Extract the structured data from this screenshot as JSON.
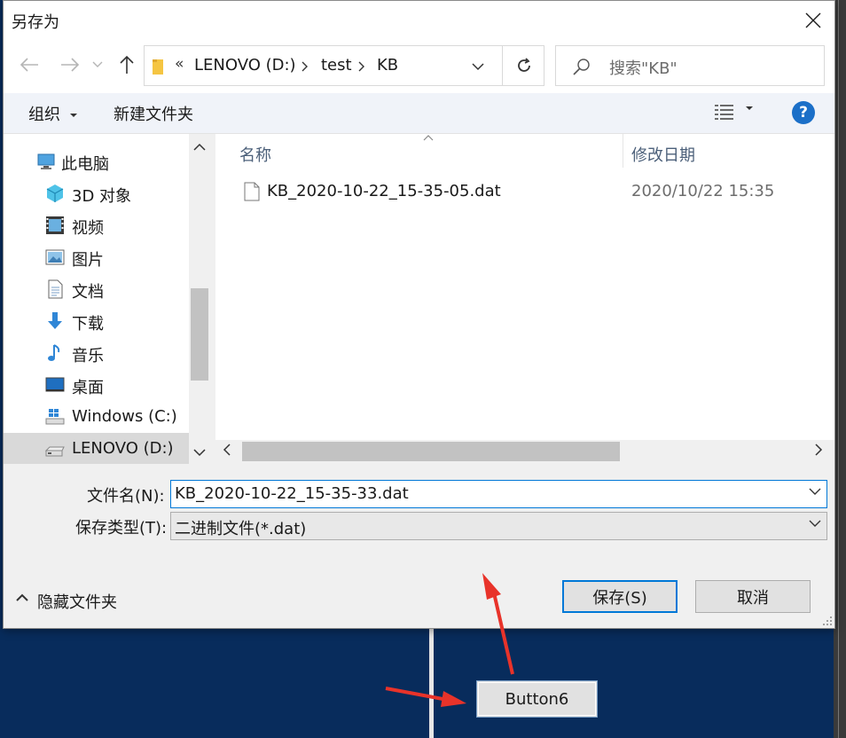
{
  "dialog": {
    "title": "另存为",
    "breadcrumb": {
      "overflow": "«",
      "items": [
        "LENOVO (D:)",
        "test",
        "KB"
      ]
    },
    "search_placeholder": "搜索\"KB\"",
    "toolbar": {
      "organize": "组织",
      "new_folder": "新建文件夹",
      "help": "?"
    },
    "nav_items": [
      {
        "label": "此电脑",
        "icon": "computer-icon"
      },
      {
        "label": "3D 对象",
        "icon": "cube-3d-icon"
      },
      {
        "label": "视频",
        "icon": "video-icon"
      },
      {
        "label": "图片",
        "icon": "pictures-icon"
      },
      {
        "label": "文档",
        "icon": "documents-icon"
      },
      {
        "label": "下载",
        "icon": "download-icon"
      },
      {
        "label": "音乐",
        "icon": "music-icon"
      },
      {
        "label": "桌面",
        "icon": "desktop-icon"
      },
      {
        "label": "Windows (C:)",
        "icon": "windows-drive-icon"
      },
      {
        "label": "LENOVO (D:)",
        "icon": "drive-icon",
        "selected": true
      }
    ],
    "columns": {
      "name": "名称",
      "modified": "修改日期"
    },
    "files": [
      {
        "name": "KB_2020-10-22_15-35-05.dat",
        "modified": "2020/10/22 15:35"
      }
    ],
    "filename_label": "文件名(N):",
    "filename_value": "KB_2020-10-22_15-35-33.dat",
    "filetype_label": "保存类型(T):",
    "filetype_value": "二进制文件(*.dat)",
    "hide_folders": "隐藏文件夹",
    "save_button": "保存(S)",
    "cancel_button": "取消"
  },
  "background": {
    "button_label": "Button6",
    "bg_color": "#082c5c",
    "annotation_color": "#e8332a"
  }
}
